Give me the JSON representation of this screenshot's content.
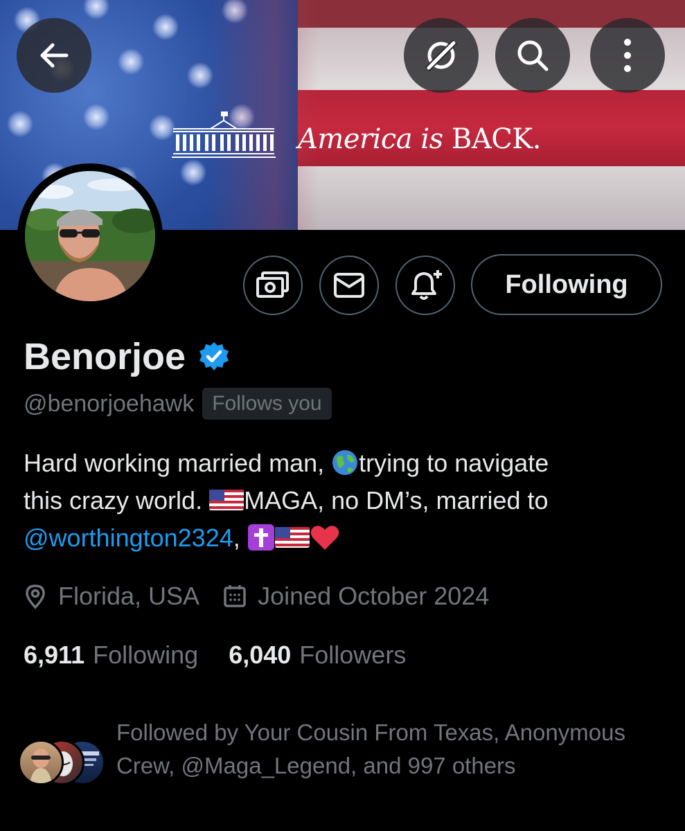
{
  "banner": {
    "text_italic": "America",
    "text_italic2": "is",
    "text_rest": "BACK.",
    "logo_icon": "white-house-icon"
  },
  "top_buttons": [
    {
      "name": "back-button",
      "icon": "arrow-left-icon"
    },
    {
      "name": "grok-button",
      "icon": "grok-icon"
    },
    {
      "name": "search-button",
      "icon": "search-icon"
    },
    {
      "name": "more-button",
      "icon": "more-vertical-icon"
    }
  ],
  "actions": {
    "subscribe_icon": "money-icon",
    "message_icon": "envelope-icon",
    "notify_icon": "bell-plus-icon",
    "following_label": "Following"
  },
  "profile": {
    "name": "Benorjoe",
    "verified": true,
    "handle": "@benorjoehawk",
    "follows_you": "Follows you",
    "bio_line1": "Hard working married man, ",
    "bio_globe": "🌍",
    "bio_line1b": "trying to navigate",
    "bio_line2a": "this crazy world. ",
    "bio_flag": "🇺🇸",
    "bio_line2b": "MAGA, no DM’s, married to",
    "bio_mention": "@worthington2324",
    "bio_tail": ", ",
    "bio_emoji_cross": "✝️",
    "bio_emoji_flag": "🇺🇸",
    "bio_emoji_heart": "❤️",
    "location": "Florida, USA",
    "joined": "Joined October 2024"
  },
  "stats": {
    "following_count": "6,911",
    "following_label": "Following",
    "followers_count": "6,040",
    "followers_label": "Followers"
  },
  "followed_by": {
    "text": "Followed by Your Cousin From Texas, Anonymous Crew, @Maga_Legend, and 997 others"
  },
  "colors": {
    "accent": "#1d9bf0",
    "muted": "#71767b",
    "text": "#e7e9ea",
    "border": "#536471",
    "background": "#000000"
  }
}
